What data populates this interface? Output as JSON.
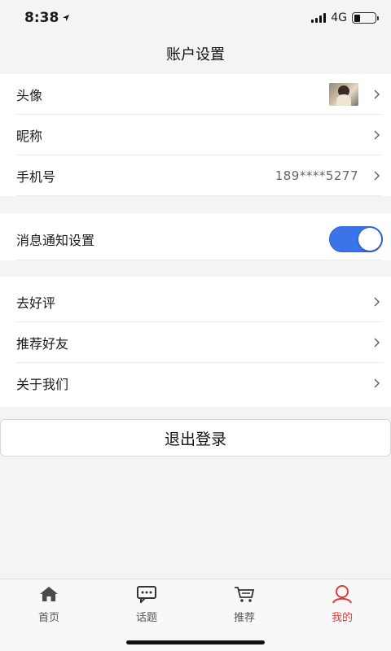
{
  "status_bar": {
    "time": "8:38",
    "network": "4G"
  },
  "nav": {
    "title": "账户设置"
  },
  "account": {
    "avatar_label": "头像",
    "nickname_label": "昵称",
    "phone_label": "手机号",
    "phone_value": "189****5277"
  },
  "notification": {
    "label": "消息通知设置",
    "enabled": true
  },
  "more": {
    "rate_label": "去好评",
    "recommend_label": "推荐好友",
    "about_label": "关于我们"
  },
  "logout_label": "退出登录",
  "tabs": [
    {
      "label": "首页",
      "icon": "home-icon",
      "active": false
    },
    {
      "label": "话题",
      "icon": "chat-icon",
      "active": false
    },
    {
      "label": "推荐",
      "icon": "cart-icon",
      "active": false
    },
    {
      "label": "我的",
      "icon": "user-icon",
      "active": true
    }
  ],
  "colors": {
    "accent": "#3a74e8",
    "active_tab": "#e23a3a",
    "background": "#f4f4f6"
  }
}
